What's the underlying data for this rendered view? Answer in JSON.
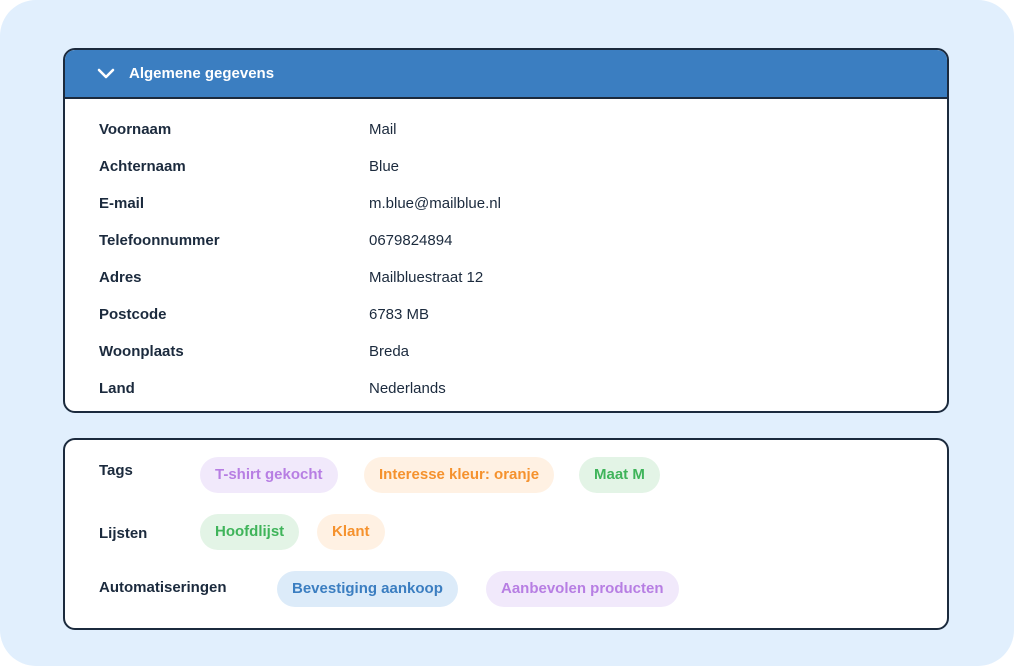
{
  "general": {
    "title": "Algemene gegevens",
    "fields": [
      {
        "label": "Voornaam",
        "value": "Mail"
      },
      {
        "label": "Achternaam",
        "value": "Blue"
      },
      {
        "label": "E-mail",
        "value": "m.blue@mailblue.nl"
      },
      {
        "label": "Telefoonnummer",
        "value": "0679824894"
      },
      {
        "label": "Adres",
        "value": "Mailbluestraat 12"
      },
      {
        "label": "Postcode",
        "value": "6783 MB"
      },
      {
        "label": "Woonplaats",
        "value": "Breda"
      },
      {
        "label": "Land",
        "value": "Nederlands"
      }
    ]
  },
  "meta": {
    "tags_label": "Tags",
    "tags": [
      "T-shirt gekocht",
      "Interesse kleur: oranje",
      "Maat M"
    ],
    "lists_label": "Lijsten",
    "lists": [
      "Hoofdlijst",
      "Klant"
    ],
    "automations_label": "Automatiseringen",
    "automations": [
      "Bevestiging aankoop",
      "Aanbevolen producten"
    ]
  },
  "colors": {
    "header_bg": "#3b7ec1",
    "border": "#1b2a3d",
    "backdrop": "#e1effd",
    "chip_purple_bg": "#f1e9fb",
    "chip_purple_fg": "#b77ee3",
    "chip_orange_bg": "#fff1e3",
    "chip_orange_fg": "#f5922e",
    "chip_green_bg": "#e3f4e6",
    "chip_green_fg": "#3fb45a",
    "chip_blue_bg": "#dcebf9",
    "chip_blue_fg": "#3b7ec1"
  }
}
